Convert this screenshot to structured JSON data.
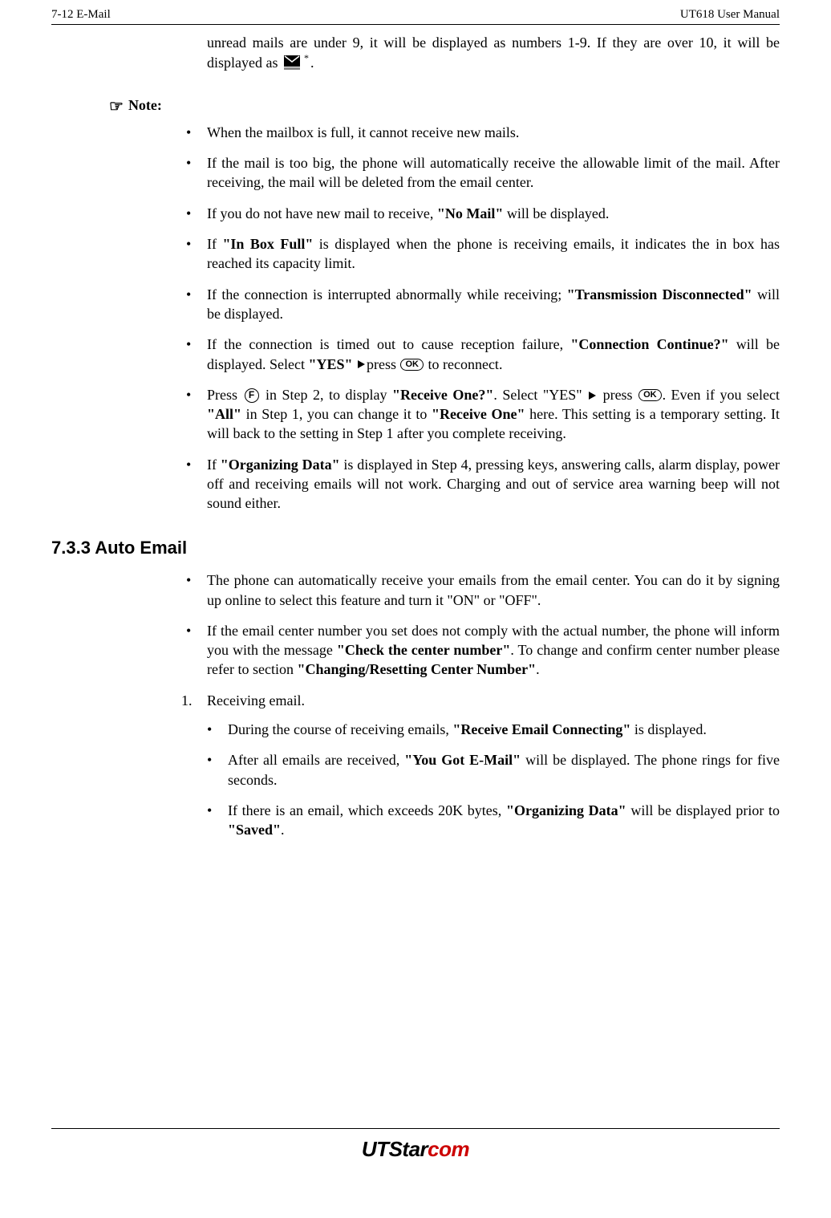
{
  "header": {
    "left": "7-12   E-Mail",
    "right": "UT618 User Manual"
  },
  "intro": {
    "pre": "unread mails are under 9, it will be displayed as numbers 1-9. If they are over 10, it will be displayed as  ",
    "post": "."
  },
  "note": {
    "icon": "hand-point-right-icon",
    "label": "Note:",
    "items": [
      {
        "segments": [
          {
            "t": "When the mailbox is full, it cannot receive new mails."
          }
        ]
      },
      {
        "segments": [
          {
            "t": "If the mail is too big, the phone will automatically receive the allowable limit of the mail. After receiving, the mail will be deleted from the email center."
          }
        ]
      },
      {
        "segments": [
          {
            "t": "If you do not have new mail to receive, "
          },
          {
            "t": "\"No Mail\"",
            "b": true
          },
          {
            "t": " will be displayed."
          }
        ]
      },
      {
        "segments": [
          {
            "t": "If "
          },
          {
            "t": "\"In Box Full\"",
            "b": true
          },
          {
            "t": " is displayed when the phone is receiving emails, it indicates the in box has reached its capacity limit."
          }
        ]
      },
      {
        "segments": [
          {
            "t": "If the connection is interrupted abnormally while receiving; "
          },
          {
            "t": "\"Transmission Disconnected\"",
            "b": true
          },
          {
            "t": " will be displayed."
          }
        ]
      },
      {
        "segments": [
          {
            "t": "If the connection is timed out to cause reception failure, "
          },
          {
            "t": "\"Connection Continue?\"",
            "b": true
          },
          {
            "t": " will be displayed. Select "
          },
          {
            "t": "\"YES\"",
            "b": true
          },
          {
            "t": " "
          },
          {
            "icon": "tri-right"
          },
          {
            "t": "press "
          },
          {
            "icon": "ok"
          },
          {
            "t": " to reconnect."
          }
        ]
      },
      {
        "segments": [
          {
            "t": "Press "
          },
          {
            "icon": "f"
          },
          {
            "t": " in Step 2, to display "
          },
          {
            "t": "\"Receive One?\"",
            "b": true
          },
          {
            "t": ". Select \"YES\" "
          },
          {
            "icon": "tri-right"
          },
          {
            "t": " press "
          },
          {
            "icon": "ok"
          },
          {
            "t": ". Even if you select "
          },
          {
            "t": "\"All\"",
            "b": true
          },
          {
            "t": " in Step 1, you can change it to "
          },
          {
            "t": "\"Receive One\"",
            "b": true
          },
          {
            "t": " here. This setting is a temporary setting. It will back to the setting in Step 1 after you complete receiving."
          }
        ]
      },
      {
        "segments": [
          {
            "t": "If "
          },
          {
            "t": "\"Organizing Data\"",
            "b": true
          },
          {
            "t": " is displayed in Step 4, pressing keys, answering calls, alarm display, power off and receiving emails will not work. Charging and out of service area warning beep will not sound either."
          }
        ]
      }
    ]
  },
  "section": {
    "heading": "7.3.3 Auto Email",
    "bullets": [
      {
        "segments": [
          {
            "t": "The phone can automatically receive your emails from the email center. You can do it by signing up online to select this feature and turn it \"ON\" or \"OFF\"."
          }
        ]
      },
      {
        "segments": [
          {
            "t": "If the email center number you set does not comply with the actual number, the phone will inform you with the message "
          },
          {
            "t": "\"Check the center number\"",
            "b": true
          },
          {
            "t": ". To change and confirm center number please refer to section "
          },
          {
            "t": "\"Changing/Resetting Center Number\"",
            "b": true
          },
          {
            "t": "."
          }
        ]
      }
    ],
    "numbered": [
      {
        "num": "1.",
        "text": "Receiving email."
      }
    ],
    "sub_bullets": [
      {
        "segments": [
          {
            "t": "During the course of receiving emails, "
          },
          {
            "t": "\"Receive Email Connecting\"",
            "b": true
          },
          {
            "t": " is displayed."
          }
        ]
      },
      {
        "segments": [
          {
            "t": "After all emails are received, "
          },
          {
            "t": "\"You Got E-Mail\"",
            "b": true
          },
          {
            "t": " will be displayed. The phone rings for five seconds."
          }
        ]
      },
      {
        "segments": [
          {
            "t": "If there is an email, which exceeds 20K bytes, "
          },
          {
            "t": "\"Organizing Data\"",
            "b": true
          },
          {
            "t": " will be displayed prior to "
          },
          {
            "t": "\"Saved\"",
            "b": true
          },
          {
            "t": "."
          }
        ]
      }
    ]
  },
  "footer": {
    "logo_ut": "UT",
    "logo_star": "Star",
    "logo_com": "com"
  },
  "icons": {
    "ok_label": "OK",
    "f_label": "F",
    "star_label": "*"
  }
}
